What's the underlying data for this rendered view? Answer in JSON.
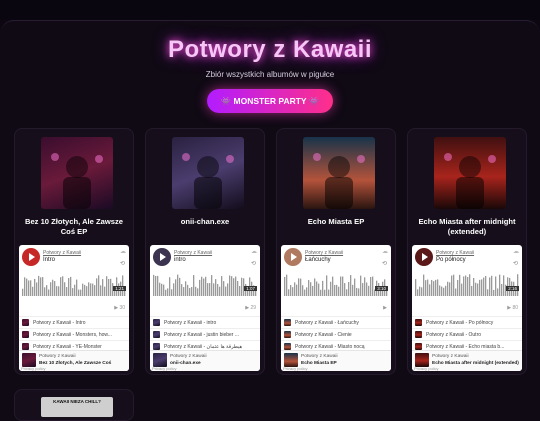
{
  "header": {
    "title": "Potwory z Kawaii",
    "subtitle": "Zbiór wszystkich albumów w pigułce",
    "party_button": "👾 MONSTER PARTY 👾"
  },
  "albums": [
    {
      "title": "Bez 10 Złotych, Ale Zawsze Coś EP",
      "accent": "#c62828",
      "artist": "Potwory z Kawaii",
      "track": "Intro",
      "duration": "1:21",
      "plays": "30",
      "tracks": [
        "Potwory z Kawaii - Intro",
        "Potwory z Kawaii - Monsters, how...",
        "Potwory z Kawaii - YE-Monster"
      ],
      "footer_artist": "Potwory z Kawaii",
      "footer_album": "Bez 10 Złotych, Ale Zawsze Coś",
      "privacy": "Privacy policy"
    },
    {
      "title": "onii-chan.exe",
      "accent": "#3b3350",
      "artist": "Potwory z Kawaii",
      "track": "intro",
      "duration": "1:07",
      "plays": "29",
      "tracks": [
        "Potwory z Kawaii - intro",
        "Potwory z Kawaii - justin bieber ...",
        "Potwory z Kawaii - هیطرقة ها عثمان"
      ],
      "footer_artist": "Potwory z Kawaii",
      "footer_album": "onii-chan.exe",
      "privacy": "Privacy policy"
    },
    {
      "title": "Echo Miasta EP",
      "accent": "#b07a60",
      "artist": "Potwory z Kawaii",
      "track": "Łańcuchy",
      "duration": "3:10",
      "plays": "",
      "tracks": [
        "Potwory z Kawaii - Łańcuchy",
        "Potwory z Kawaii - Cienie",
        "Potwory z Kawaii - Miasto nocą"
      ],
      "footer_artist": "Potwory z Kawaii",
      "footer_album": "Echo Miasta EP",
      "privacy": "Privacy policy"
    },
    {
      "title": "Echo Miasta after midnight (extended)",
      "accent": "#5a1818",
      "artist": "Potwory z Kawaii",
      "track": "Po północy",
      "duration": "2:16",
      "plays": "80",
      "tracks": [
        "Potwory z Kawaii - Po północy",
        "Potwory z Kawaii - Outro",
        "Potwory z Kawaii - Echo miasta b..."
      ],
      "footer_artist": "Potwory z Kawaii",
      "footer_album": "Echo Miasta after midnight (extended)",
      "privacy": "Privacy policy"
    }
  ],
  "fifth_cover_text": "KAWAII NIEZA CHILL?",
  "icons": {
    "soundcloud": "cloud-icon",
    "repeat": "repeat-icon",
    "play": "play-icon"
  }
}
